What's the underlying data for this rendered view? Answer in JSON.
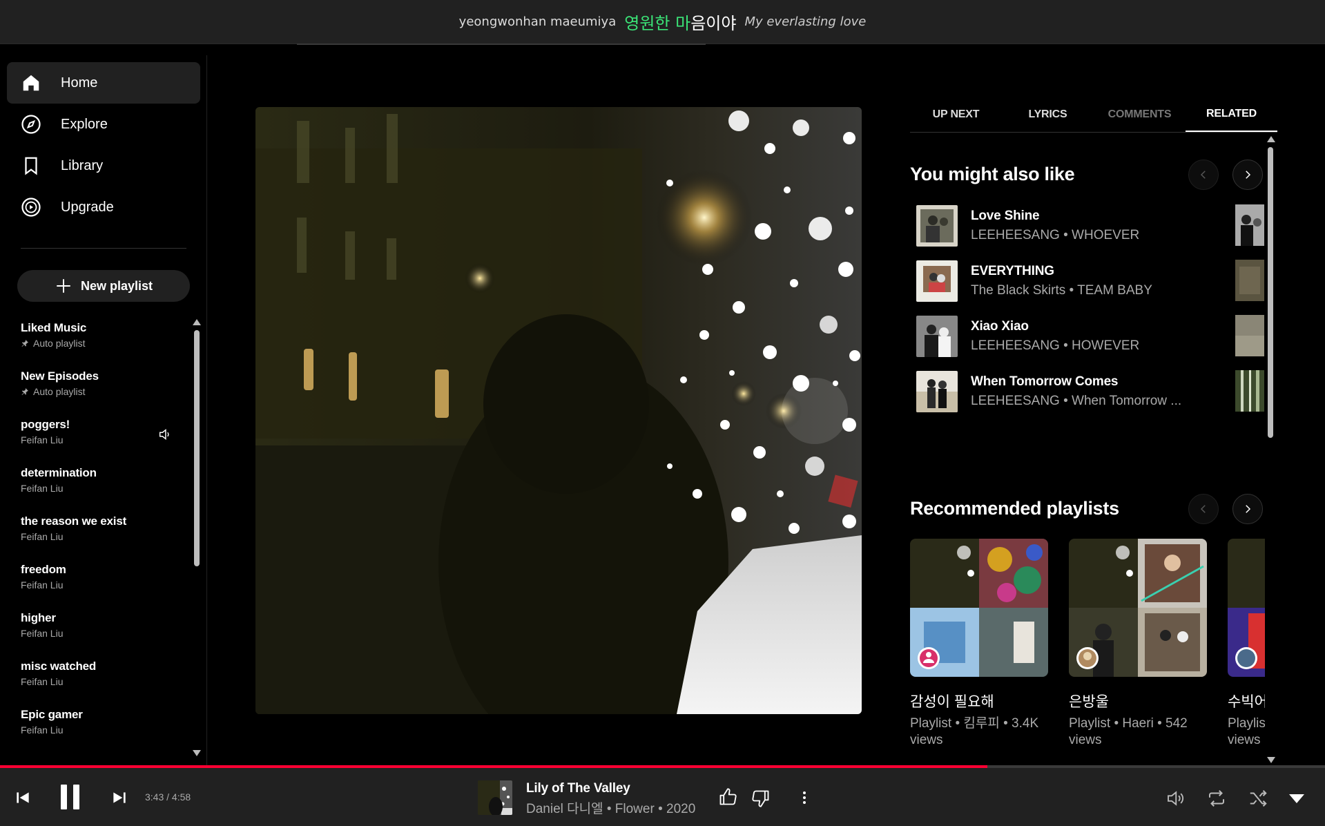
{
  "lyrics": {
    "romanized": "yeongwonhan maeumiya",
    "korean_sung": "영원한 마",
    "korean_unsung": "음이야",
    "translation": "My everlasting love"
  },
  "sidebar": {
    "nav": [
      {
        "label": "Home",
        "icon": "home-icon",
        "active": true
      },
      {
        "label": "Explore",
        "icon": "compass-icon"
      },
      {
        "label": "Library",
        "icon": "bookmark-icon"
      },
      {
        "label": "Upgrade",
        "icon": "play-circle-icon"
      }
    ],
    "new_playlist_label": "New playlist",
    "playlists": [
      {
        "title": "Liked Music",
        "subtitle": "Auto playlist",
        "pinned": true
      },
      {
        "title": "New Episodes",
        "subtitle": "Auto playlist",
        "pinned": true
      },
      {
        "title": "poggers!",
        "subtitle": "Feifan Liu",
        "playing": true
      },
      {
        "title": "determination",
        "subtitle": "Feifan Liu"
      },
      {
        "title": "the reason we exist",
        "subtitle": "Feifan Liu"
      },
      {
        "title": "freedom",
        "subtitle": "Feifan Liu"
      },
      {
        "title": "higher",
        "subtitle": "Feifan Liu"
      },
      {
        "title": "misc watched",
        "subtitle": "Feifan Liu"
      },
      {
        "title": "Epic gamer",
        "subtitle": "Feifan Liu"
      }
    ]
  },
  "tabs": [
    {
      "label": "UP NEXT"
    },
    {
      "label": "LYRICS"
    },
    {
      "label": "COMMENTS",
      "dim": true
    },
    {
      "label": "RELATED",
      "active": true
    }
  ],
  "related": {
    "also_like_title": "You might also like",
    "songs": [
      {
        "title": "Love Shine",
        "subtitle": "LEEHEESANG • WHOEVER"
      },
      {
        "title": "EVERYTHING",
        "subtitle": "The Black Skirts • TEAM BABY"
      },
      {
        "title": "Xiao Xiao",
        "subtitle": "LEEHEESANG • HOWEVER"
      },
      {
        "title": "When Tomorrow Comes",
        "subtitle": "LEEHEESANG • When Tomorrow ..."
      }
    ],
    "recommended_title": "Recommended playlists",
    "playlists": [
      {
        "title": "감성이 필요해",
        "subtitle": "Playlist • 킴루피 • 3.4K views"
      },
      {
        "title": "은방울",
        "subtitle": "Playlist • Haeri • 542 views"
      },
      {
        "title": "수빅어",
        "subtitle": "Playlis views"
      }
    ]
  },
  "player": {
    "time": "3:43 / 4:58",
    "progress": 0.745,
    "title": "Lily of The Valley",
    "subtitle": "Daniel 다니엘 • Flower • 2020",
    "accent_color": "#ff0033",
    "lyric_color": "#3be477"
  }
}
